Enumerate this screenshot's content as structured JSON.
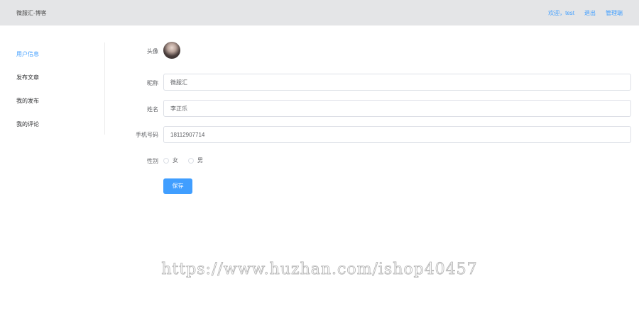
{
  "header": {
    "brand": "微服汇-博客",
    "welcome": "欢迎，test",
    "logout": "退出",
    "admin": "管理端"
  },
  "sidebar": {
    "items": [
      {
        "label": "用户信息",
        "active": true
      },
      {
        "label": "发布文章",
        "active": false
      },
      {
        "label": "我的发布",
        "active": false
      },
      {
        "label": "我的评论",
        "active": false
      }
    ]
  },
  "form": {
    "avatar_label": "头像",
    "nickname_label": "昵称",
    "nickname_value": "微服汇",
    "name_label": "姓名",
    "name_value": "李正乐",
    "phone_label": "手机号码",
    "phone_value": "18112907714",
    "gender_label": "性别",
    "gender_options": [
      "女",
      "男"
    ],
    "save_label": "保存"
  },
  "watermark": "https://www.huzhan.com/ishop40457",
  "colors": {
    "accent": "#409eff",
    "topbar": "#e4e5e7"
  }
}
